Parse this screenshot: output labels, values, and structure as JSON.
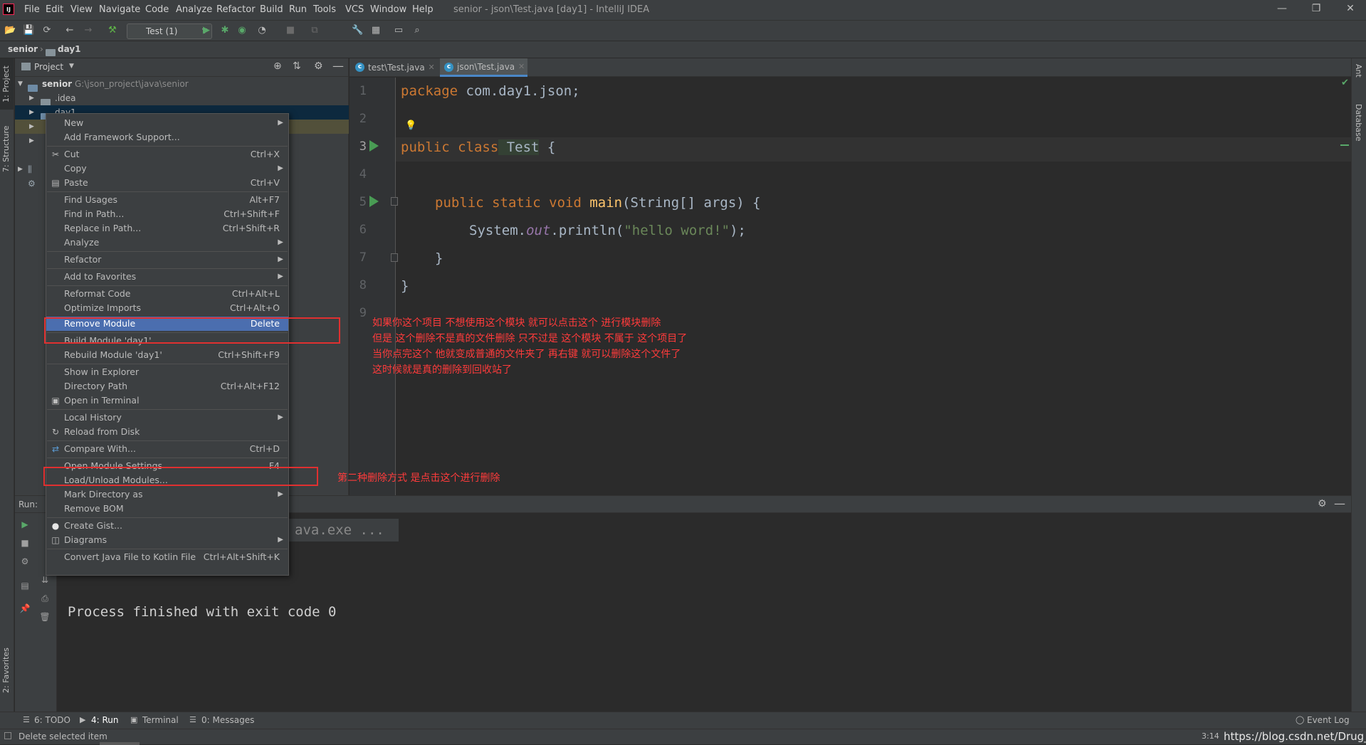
{
  "window": {
    "title": "senior - json\\Test.java [day1] - IntelliJ IDEA",
    "app_icon_text": "IJ",
    "controls": [
      "—",
      "❐",
      "✕"
    ]
  },
  "menu_bar": [
    "File",
    "Edit",
    "View",
    "Navigate",
    "Code",
    "Analyze",
    "Refactor",
    "Build",
    "Run",
    "Tools",
    "VCS",
    "Window",
    "Help"
  ],
  "toolbar": {
    "run_config": "Test (1)"
  },
  "breadcrumb": {
    "root": "senior",
    "child": "day1"
  },
  "left_stripe": {
    "project_tab": "1: Project",
    "structure_tab": "7: Structure",
    "favorites_tab": "2: Favorites"
  },
  "right_stripe": {
    "ant_tab": "Ant",
    "database_tab": "Database"
  },
  "project_panel": {
    "header": "Project",
    "tree": [
      {
        "name": "senior",
        "path": "G:\\json_project\\java\\senior"
      },
      {
        "name": ".idea"
      },
      {
        "name": "day1"
      }
    ]
  },
  "editor": {
    "tabs": [
      {
        "label": "test\\Test.java",
        "active": false
      },
      {
        "label": "json\\Test.java",
        "active": true
      }
    ],
    "line_numbers": [
      "1",
      "2",
      "3",
      "4",
      "5",
      "6",
      "7",
      "8",
      "9"
    ],
    "code": {
      "l1_kw": "package",
      "l1_rest": " com.day1.json;",
      "l3_kw": "public class",
      "l3_name": " Test",
      "l3_rest": " {",
      "l5_kw": "public static void",
      "l5_fn": " main",
      "l5_rest": "(String[] args) {",
      "l6_a": "System.",
      "l6_out": "out",
      "l6_b": ".println(",
      "l6_str": "\"hello word!\"",
      "l6_c": ");",
      "l7": "}",
      "l8": "}"
    }
  },
  "annotations": {
    "note1": [
      "如果你这个项目 不想使用这个模块  就可以点击这个 进行模块删除",
      "但是 这个删除不是真的文件删除  只不过是 这个模块 不属于 这个项目了",
      "当你点完这个  他就变成普通的文件夹了  再右键 就可以删除这个文件了",
      "这时候就是真的删除到回收站了"
    ],
    "note2": "第二种删除方式  是点击这个进行删除"
  },
  "context_menu": {
    "items": [
      {
        "label": "New",
        "submenu": true
      },
      {
        "label": "Add Framework Support..."
      },
      {
        "label": "Cut",
        "shortcut": "Ctrl+X",
        "icon": "✂"
      },
      {
        "label": "Copy",
        "submenu": true
      },
      {
        "label": "Paste",
        "shortcut": "Ctrl+V",
        "icon": "▤"
      },
      {
        "label": "Find Usages",
        "shortcut": "Alt+F7"
      },
      {
        "label": "Find in Path...",
        "shortcut": "Ctrl+Shift+F"
      },
      {
        "label": "Replace in Path...",
        "shortcut": "Ctrl+Shift+R"
      },
      {
        "label": "Analyze",
        "submenu": true
      },
      {
        "label": "Refactor",
        "submenu": true
      },
      {
        "label": "Add to Favorites",
        "submenu": true
      },
      {
        "label": "Reformat Code",
        "shortcut": "Ctrl+Alt+L"
      },
      {
        "label": "Optimize Imports",
        "shortcut": "Ctrl+Alt+O"
      },
      {
        "label": "Remove Module",
        "shortcut": "Delete",
        "selected": true
      },
      {
        "label": "Build Module 'day1'"
      },
      {
        "label": "Rebuild Module 'day1'",
        "shortcut": "Ctrl+Shift+F9"
      },
      {
        "label": "Show in Explorer"
      },
      {
        "label": "Directory Path",
        "shortcut": "Ctrl+Alt+F12"
      },
      {
        "label": "Open in Terminal",
        "icon": "▣"
      },
      {
        "label": "Local History",
        "submenu": true
      },
      {
        "label": "Reload from Disk",
        "icon": "↻"
      },
      {
        "label": "Compare With...",
        "shortcut": "Ctrl+D",
        "icon": "⇄"
      },
      {
        "label": "Open Module Settings",
        "shortcut": "F4"
      },
      {
        "label": "Load/Unload Modules..."
      },
      {
        "label": "Mark Directory as",
        "submenu": true
      },
      {
        "label": "Remove BOM"
      },
      {
        "label": "Create Gist...",
        "icon": "●"
      },
      {
        "label": "Diagrams",
        "submenu": true,
        "icon": "◫"
      },
      {
        "label": "Convert Java File to Kotlin File",
        "shortcut": "Ctrl+Alt+Shift+K"
      }
    ]
  },
  "run_panel": {
    "label": "Run:",
    "partial_cmd": "ava.exe ...",
    "output": "Process finished with exit code 0"
  },
  "bottom_tabs": [
    {
      "label": "6: TODO"
    },
    {
      "label": "4: Run"
    },
    {
      "label": "Terminal"
    },
    {
      "label": "0: Messages"
    }
  ],
  "event_log": "Event Log",
  "status": {
    "message": "Delete selected item",
    "position": "3:14",
    "watermark": "https://blog.csdn.net/Drug_"
  }
}
